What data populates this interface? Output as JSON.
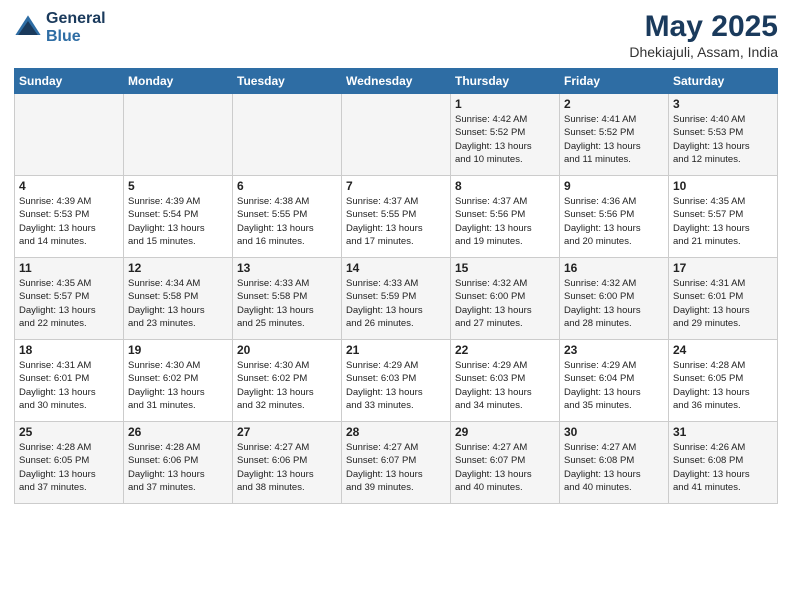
{
  "header": {
    "logo_line1": "General",
    "logo_line2": "Blue",
    "month_year": "May 2025",
    "location": "Dhekiajuli, Assam, India"
  },
  "weekdays": [
    "Sunday",
    "Monday",
    "Tuesday",
    "Wednesday",
    "Thursday",
    "Friday",
    "Saturday"
  ],
  "weeks": [
    [
      {
        "day": "",
        "info": ""
      },
      {
        "day": "",
        "info": ""
      },
      {
        "day": "",
        "info": ""
      },
      {
        "day": "",
        "info": ""
      },
      {
        "day": "1",
        "info": "Sunrise: 4:42 AM\nSunset: 5:52 PM\nDaylight: 13 hours\nand 10 minutes."
      },
      {
        "day": "2",
        "info": "Sunrise: 4:41 AM\nSunset: 5:52 PM\nDaylight: 13 hours\nand 11 minutes."
      },
      {
        "day": "3",
        "info": "Sunrise: 4:40 AM\nSunset: 5:53 PM\nDaylight: 13 hours\nand 12 minutes."
      }
    ],
    [
      {
        "day": "4",
        "info": "Sunrise: 4:39 AM\nSunset: 5:53 PM\nDaylight: 13 hours\nand 14 minutes."
      },
      {
        "day": "5",
        "info": "Sunrise: 4:39 AM\nSunset: 5:54 PM\nDaylight: 13 hours\nand 15 minutes."
      },
      {
        "day": "6",
        "info": "Sunrise: 4:38 AM\nSunset: 5:55 PM\nDaylight: 13 hours\nand 16 minutes."
      },
      {
        "day": "7",
        "info": "Sunrise: 4:37 AM\nSunset: 5:55 PM\nDaylight: 13 hours\nand 17 minutes."
      },
      {
        "day": "8",
        "info": "Sunrise: 4:37 AM\nSunset: 5:56 PM\nDaylight: 13 hours\nand 19 minutes."
      },
      {
        "day": "9",
        "info": "Sunrise: 4:36 AM\nSunset: 5:56 PM\nDaylight: 13 hours\nand 20 minutes."
      },
      {
        "day": "10",
        "info": "Sunrise: 4:35 AM\nSunset: 5:57 PM\nDaylight: 13 hours\nand 21 minutes."
      }
    ],
    [
      {
        "day": "11",
        "info": "Sunrise: 4:35 AM\nSunset: 5:57 PM\nDaylight: 13 hours\nand 22 minutes."
      },
      {
        "day": "12",
        "info": "Sunrise: 4:34 AM\nSunset: 5:58 PM\nDaylight: 13 hours\nand 23 minutes."
      },
      {
        "day": "13",
        "info": "Sunrise: 4:33 AM\nSunset: 5:58 PM\nDaylight: 13 hours\nand 25 minutes."
      },
      {
        "day": "14",
        "info": "Sunrise: 4:33 AM\nSunset: 5:59 PM\nDaylight: 13 hours\nand 26 minutes."
      },
      {
        "day": "15",
        "info": "Sunrise: 4:32 AM\nSunset: 6:00 PM\nDaylight: 13 hours\nand 27 minutes."
      },
      {
        "day": "16",
        "info": "Sunrise: 4:32 AM\nSunset: 6:00 PM\nDaylight: 13 hours\nand 28 minutes."
      },
      {
        "day": "17",
        "info": "Sunrise: 4:31 AM\nSunset: 6:01 PM\nDaylight: 13 hours\nand 29 minutes."
      }
    ],
    [
      {
        "day": "18",
        "info": "Sunrise: 4:31 AM\nSunset: 6:01 PM\nDaylight: 13 hours\nand 30 minutes."
      },
      {
        "day": "19",
        "info": "Sunrise: 4:30 AM\nSunset: 6:02 PM\nDaylight: 13 hours\nand 31 minutes."
      },
      {
        "day": "20",
        "info": "Sunrise: 4:30 AM\nSunset: 6:02 PM\nDaylight: 13 hours\nand 32 minutes."
      },
      {
        "day": "21",
        "info": "Sunrise: 4:29 AM\nSunset: 6:03 PM\nDaylight: 13 hours\nand 33 minutes."
      },
      {
        "day": "22",
        "info": "Sunrise: 4:29 AM\nSunset: 6:03 PM\nDaylight: 13 hours\nand 34 minutes."
      },
      {
        "day": "23",
        "info": "Sunrise: 4:29 AM\nSunset: 6:04 PM\nDaylight: 13 hours\nand 35 minutes."
      },
      {
        "day": "24",
        "info": "Sunrise: 4:28 AM\nSunset: 6:05 PM\nDaylight: 13 hours\nand 36 minutes."
      }
    ],
    [
      {
        "day": "25",
        "info": "Sunrise: 4:28 AM\nSunset: 6:05 PM\nDaylight: 13 hours\nand 37 minutes."
      },
      {
        "day": "26",
        "info": "Sunrise: 4:28 AM\nSunset: 6:06 PM\nDaylight: 13 hours\nand 37 minutes."
      },
      {
        "day": "27",
        "info": "Sunrise: 4:27 AM\nSunset: 6:06 PM\nDaylight: 13 hours\nand 38 minutes."
      },
      {
        "day": "28",
        "info": "Sunrise: 4:27 AM\nSunset: 6:07 PM\nDaylight: 13 hours\nand 39 minutes."
      },
      {
        "day": "29",
        "info": "Sunrise: 4:27 AM\nSunset: 6:07 PM\nDaylight: 13 hours\nand 40 minutes."
      },
      {
        "day": "30",
        "info": "Sunrise: 4:27 AM\nSunset: 6:08 PM\nDaylight: 13 hours\nand 40 minutes."
      },
      {
        "day": "31",
        "info": "Sunrise: 4:26 AM\nSunset: 6:08 PM\nDaylight: 13 hours\nand 41 minutes."
      }
    ]
  ]
}
